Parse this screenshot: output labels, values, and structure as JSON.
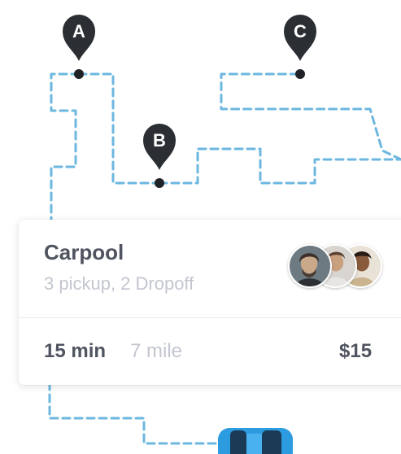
{
  "pins": {
    "a": "A",
    "b": "B",
    "c": "C"
  },
  "card": {
    "title": "Carpool",
    "subtitle": "3 pickup, 2 Dropoff",
    "duration": "15 min",
    "distance": "7 mile",
    "price": "$15"
  },
  "colors": {
    "route": "#6cb7df",
    "pin": "#2b2f33",
    "car": "#2d9be0",
    "text_primary": "#4f5460",
    "text_secondary": "#c3c6d0"
  },
  "icons": {
    "pin": "map-pin-icon",
    "car": "car-icon"
  }
}
